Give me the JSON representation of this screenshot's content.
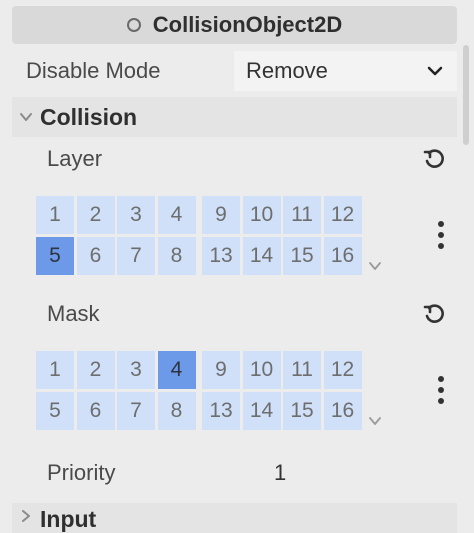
{
  "header": {
    "title": "CollisionObject2D",
    "icon": "circle-node-icon"
  },
  "disable_mode": {
    "label": "Disable Mode",
    "value": "Remove"
  },
  "sections": {
    "collision": {
      "title": "Collision"
    },
    "input": {
      "title": "Input"
    }
  },
  "layer": {
    "label": "Layer",
    "bits": [
      "1",
      "2",
      "3",
      "4",
      "9",
      "10",
      "11",
      "12",
      "5",
      "6",
      "7",
      "8",
      "13",
      "14",
      "15",
      "16"
    ],
    "active": [
      "5"
    ]
  },
  "mask": {
    "label": "Mask",
    "bits": [
      "1",
      "2",
      "3",
      "4",
      "9",
      "10",
      "11",
      "12",
      "5",
      "6",
      "7",
      "8",
      "13",
      "14",
      "15",
      "16"
    ],
    "active": [
      "4"
    ]
  },
  "priority": {
    "label": "Priority",
    "value": "1"
  },
  "colors": {
    "cell": "#cfe0f8",
    "cell_active": "#6c9ae8",
    "panel": "#ececec"
  }
}
